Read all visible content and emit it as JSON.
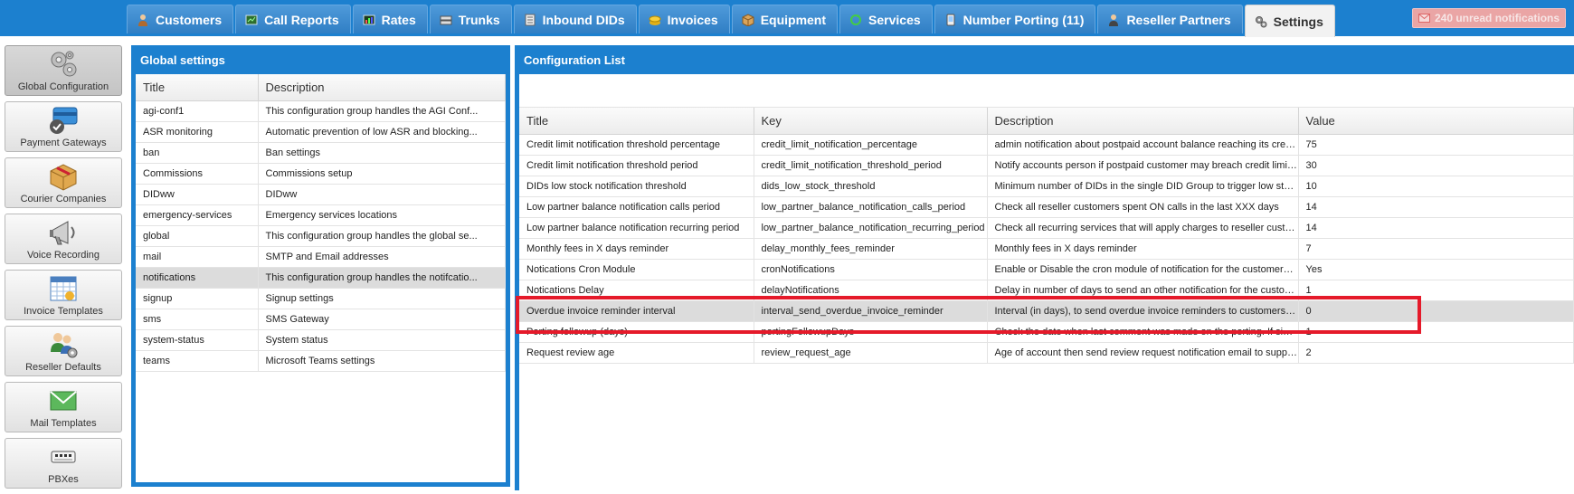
{
  "nav": {
    "tabs": [
      {
        "label": "Customers",
        "icon": "person-icon"
      },
      {
        "label": "Call Reports",
        "icon": "call-report-icon"
      },
      {
        "label": "Rates",
        "icon": "rates-icon"
      },
      {
        "label": "Trunks",
        "icon": "trunks-icon"
      },
      {
        "label": "Inbound DIDs",
        "icon": "inbound-did-icon"
      },
      {
        "label": "Invoices",
        "icon": "coins-icon"
      },
      {
        "label": "Equipment",
        "icon": "box-icon"
      },
      {
        "label": "Services",
        "icon": "refresh-icon"
      },
      {
        "label": "Number Porting (11)",
        "icon": "phone-icon"
      },
      {
        "label": "Reseller Partners",
        "icon": "partner-icon"
      },
      {
        "label": "Settings",
        "icon": "gears-icon",
        "active": true
      }
    ],
    "notifications_label": "240 unread notifications"
  },
  "sidebar": {
    "items": [
      {
        "label": "Global Configuration",
        "icon": "gears-icon",
        "active": true
      },
      {
        "label": "Payment Gateways",
        "icon": "payment-card-icon"
      },
      {
        "label": "Courier Companies",
        "icon": "package-icon"
      },
      {
        "label": "Voice Recording",
        "icon": "megaphone-icon"
      },
      {
        "label": "Invoice Templates",
        "icon": "calendar-icon"
      },
      {
        "label": "Reseller Defaults",
        "icon": "users-gear-icon"
      },
      {
        "label": "Mail Templates",
        "icon": "envelope-icon"
      },
      {
        "label": "PBXes",
        "icon": "pbx-icon"
      }
    ]
  },
  "global_settings": {
    "title": "Global settings",
    "columns": [
      "Title",
      "Description"
    ],
    "rows": [
      [
        "agi-conf1",
        "This configuration group handles the AGI Conf..."
      ],
      [
        "ASR monitoring",
        "Automatic prevention of low ASR and blocking..."
      ],
      [
        "ban",
        "Ban settings"
      ],
      [
        "Commissions",
        "Commissions setup"
      ],
      [
        "DIDww",
        "DIDww"
      ],
      [
        "emergency-services",
        "Emergency services locations"
      ],
      [
        "global",
        "This configuration group handles the global se..."
      ],
      [
        "mail",
        "SMTP and Email addresses"
      ],
      [
        "notifications",
        "This configuration group handles the notifcatio..."
      ],
      [
        "signup",
        "Signup settings"
      ],
      [
        "sms",
        "SMS Gateway"
      ],
      [
        "system-status",
        "System status"
      ],
      [
        "teams",
        "Microsoft Teams settings"
      ]
    ],
    "selected_row": 8
  },
  "config_list": {
    "title": "Configuration List",
    "columns": [
      "Title",
      "Key",
      "Description",
      "Value"
    ],
    "rows": [
      [
        "Credit limit notification threshold percentage",
        "credit_limit_notification_percentage",
        "admin notification about postpaid account balance reaching its credit limit",
        "75"
      ],
      [
        "Credit limit notification threshold period",
        "credit_limit_notification_threshold_period",
        "Notify accounts person if postpaid customer may breach credit limit in n...",
        "30"
      ],
      [
        "DIDs low stock notification threshold",
        "dids_low_stock_threshold",
        "Minimum number of DIDs in the single DID Group to trigger low stock n...",
        "10"
      ],
      [
        "Low partner balance notification calls period",
        "low_partner_balance_notification_calls_period",
        "Check all reseller customers spent ON calls in the last XXX days",
        "14"
      ],
      [
        "Low partner balance notification recurring period",
        "low_partner_balance_notification_recurring_period",
        "Check all recurring services that will apply charges to reseller customer...",
        "14"
      ],
      [
        "Monthly fees in X days reminder",
        "delay_monthly_fees_reminder",
        "Monthly fees in X days reminder",
        "7"
      ],
      [
        "Notications Cron Module",
        "cronNotifications",
        "Enable or Disable the cron module of notification for the customers. If it ...",
        "Yes"
      ],
      [
        "Notications Delay",
        "delayNotifications",
        "Delay in number of days to send an other notification for the customers...",
        "1"
      ],
      [
        "Overdue invoice reminder interval",
        "interval_send_overdue_invoice_reminder",
        "Interval (in days), to send overdue invoice reminders to customers. Firs...",
        "0"
      ],
      [
        "Porting followup (days)",
        "portingFollowupDays",
        "Check the date when last comment was made on the porting. If since th...",
        "1"
      ],
      [
        "Request review age",
        "review_request_age",
        "Age of account then send review request notification email to support",
        "2"
      ]
    ],
    "selected_row": 8
  }
}
